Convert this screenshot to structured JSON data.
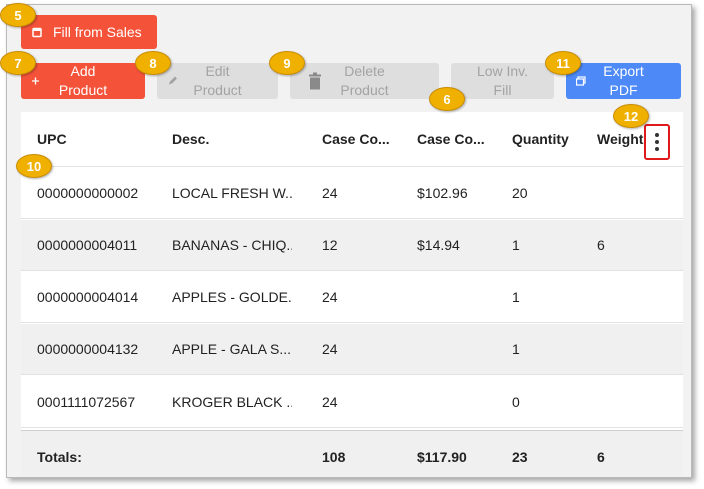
{
  "toolbar": {
    "fill_from_sales": "Fill from Sales",
    "add_product_line1": "Add",
    "add_product_line2": "Product",
    "edit_product_line1": "Edit",
    "edit_product_line2": "Product",
    "delete_product_line1": "Delete",
    "delete_product_line2": "Product",
    "low_inv_line1": "Low Inv.",
    "low_inv_line2": "Fill",
    "export_line1": "Export",
    "export_line2": "PDF"
  },
  "colors": {
    "primary_red": "#f4533a",
    "primary_blue": "#4e8af7",
    "disabled_gray": "#dedede",
    "callout": "#f0b000",
    "highlight_border": "#e0191b"
  },
  "table": {
    "headers": [
      "UPC",
      "Desc.",
      "Case Co...",
      "Case Co...",
      "Quantity",
      "Weight"
    ],
    "rows": [
      [
        "0000000000002",
        "LOCAL FRESH W...",
        "24",
        "$102.96",
        "20",
        ""
      ],
      [
        "0000000004011",
        "BANANAS - CHIQ...",
        "12",
        "$14.94",
        "1",
        "6"
      ],
      [
        "0000000004014",
        "APPLES - GOLDE...",
        "24",
        "",
        "1",
        ""
      ],
      [
        "0000000004132",
        "APPLE - GALA S...",
        "24",
        "",
        "1",
        ""
      ],
      [
        "0001111072567",
        "KROGER BLACK ...",
        "24",
        "",
        "0",
        ""
      ]
    ],
    "totals": [
      "Totals:",
      "",
      "108",
      "$117.90",
      "23",
      "6"
    ]
  },
  "callouts": [
    "5",
    "7",
    "8",
    "9",
    "6",
    "11",
    "12",
    "10"
  ]
}
